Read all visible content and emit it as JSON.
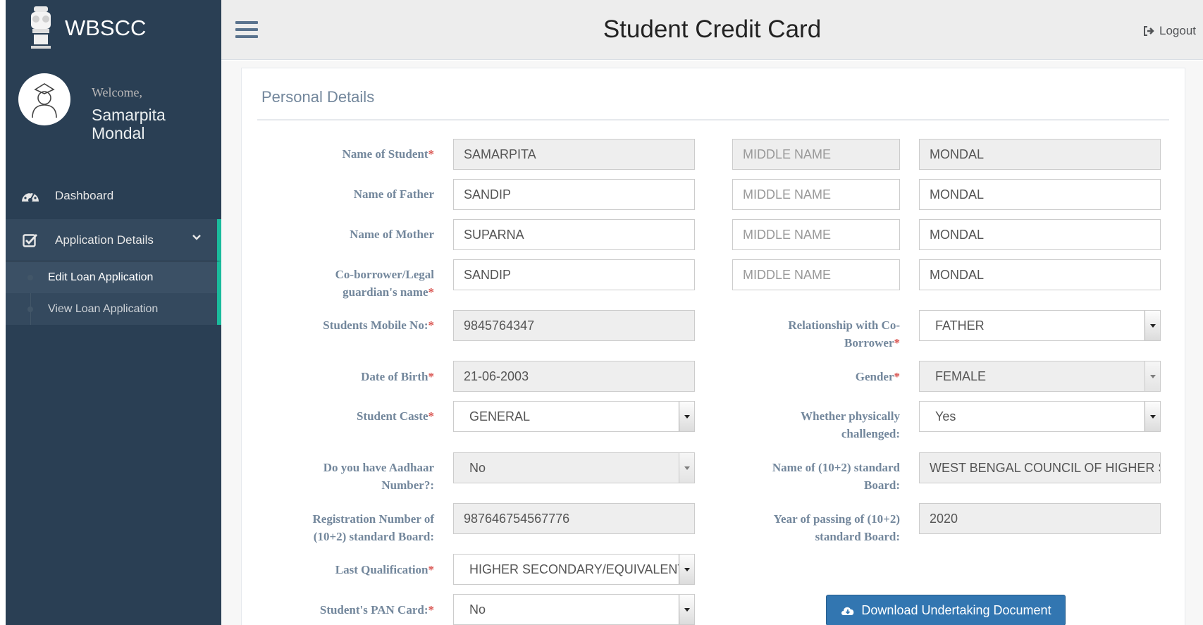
{
  "sidebar": {
    "brand": "WBSCC",
    "welcome": "Welcome,",
    "user_name": "Samarpita Mondal",
    "dashboard": "Dashboard",
    "application_details": "Application Details",
    "sub_items": [
      "Edit Loan Application",
      "View Loan Application"
    ]
  },
  "header": {
    "title": "Student Credit Card",
    "logout": "Logout"
  },
  "panel": {
    "title": "Personal Details"
  },
  "form": {
    "student_name_label": "Name of Student",
    "student_first": "SAMARPITA",
    "student_middle_placeholder": "MIDDLE NAME",
    "student_last": "MONDAL",
    "father_name_label": "Name of Father",
    "father_first": "SANDIP",
    "father_middle_placeholder": "MIDDLE NAME",
    "father_last": "MONDAL",
    "mother_name_label": "Name of Mother",
    "mother_first": "SUPARNA",
    "mother_middle_placeholder": "MIDDLE NAME",
    "mother_last": "MONDAL",
    "coborrower_label_line1": "Co-borrower/Legal",
    "coborrower_label_line2": "guardian's name",
    "coborrower_first": "SANDIP",
    "coborrower_middle_placeholder": "MIDDLE NAME",
    "coborrower_last": "MONDAL",
    "mobile_label": "Students Mobile No:",
    "mobile_value": "9845764347",
    "relationship_label_line1": "Relationship with Co-",
    "relationship_label_line2": "Borrower",
    "relationship_value": "FATHER",
    "dob_label": "Date of Birth",
    "dob_value": "21-06-2003",
    "gender_label": "Gender",
    "gender_value": "FEMALE",
    "caste_label": "Student Caste",
    "caste_value": "GENERAL",
    "physically_label_line1": "Whether physically",
    "physically_label_line2": "challenged:",
    "physically_value": "Yes",
    "aadhaar_label_line1": "Do you have Aadhaar",
    "aadhaar_label_line2": "Number?:",
    "aadhaar_value": "No",
    "board_label_line1": "Name of (10+2) standard",
    "board_label_line2": "Board:",
    "board_value": "WEST BENGAL COUNCIL OF HIGHER SECONDARY EDUCATION",
    "regno_label_line1": "Registration Number of",
    "regno_label_line2": "(10+2) standard Board:",
    "regno_value": "987646754567776",
    "year_label_line1": "Year of passing of (10+2)",
    "year_label_line2": "standard Board:",
    "year_value": "2020",
    "qualification_label": "Last Qualification",
    "qualification_value": "HIGHER SECONDARY/EQUIVALENT",
    "pan_label": "Student's PAN Card:",
    "pan_value": "No",
    "required_mark": "*",
    "download_button": "Download Undertaking Document"
  }
}
